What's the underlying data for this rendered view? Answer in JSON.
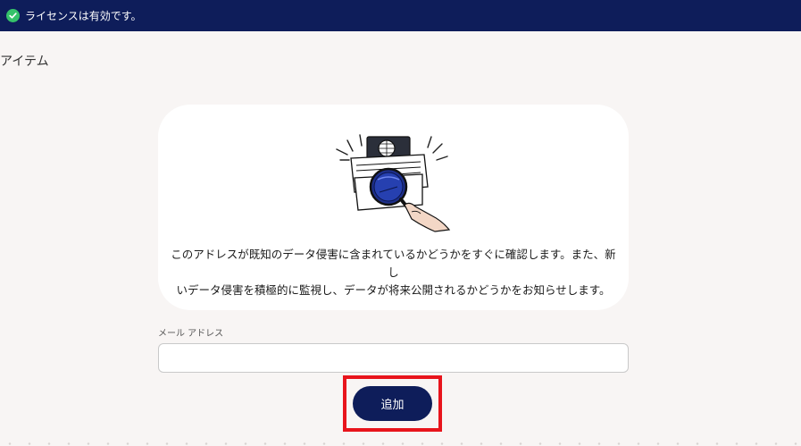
{
  "banner": {
    "icon": "check-circle-icon",
    "text": "ライセンスは有効です。",
    "color": "#0e1d5a",
    "icon_color": "#35c26a"
  },
  "section": {
    "title": "アイテム"
  },
  "card": {
    "illustration": "passport-magnifier-illustration",
    "description_line1": "このアドレスが既知のデータ侵害に含まれているかどうかをすぐに確認します。また、新し",
    "description_line2": "いデータ侵害を積極的に監視し、データが将来公開されるかどうかをお知らせします。"
  },
  "form": {
    "email_label": "メール アドレス",
    "email_value": "",
    "email_placeholder": "",
    "add_label": "追加",
    "button_color": "#0e1d5a",
    "highlight_color": "#e8141c"
  }
}
